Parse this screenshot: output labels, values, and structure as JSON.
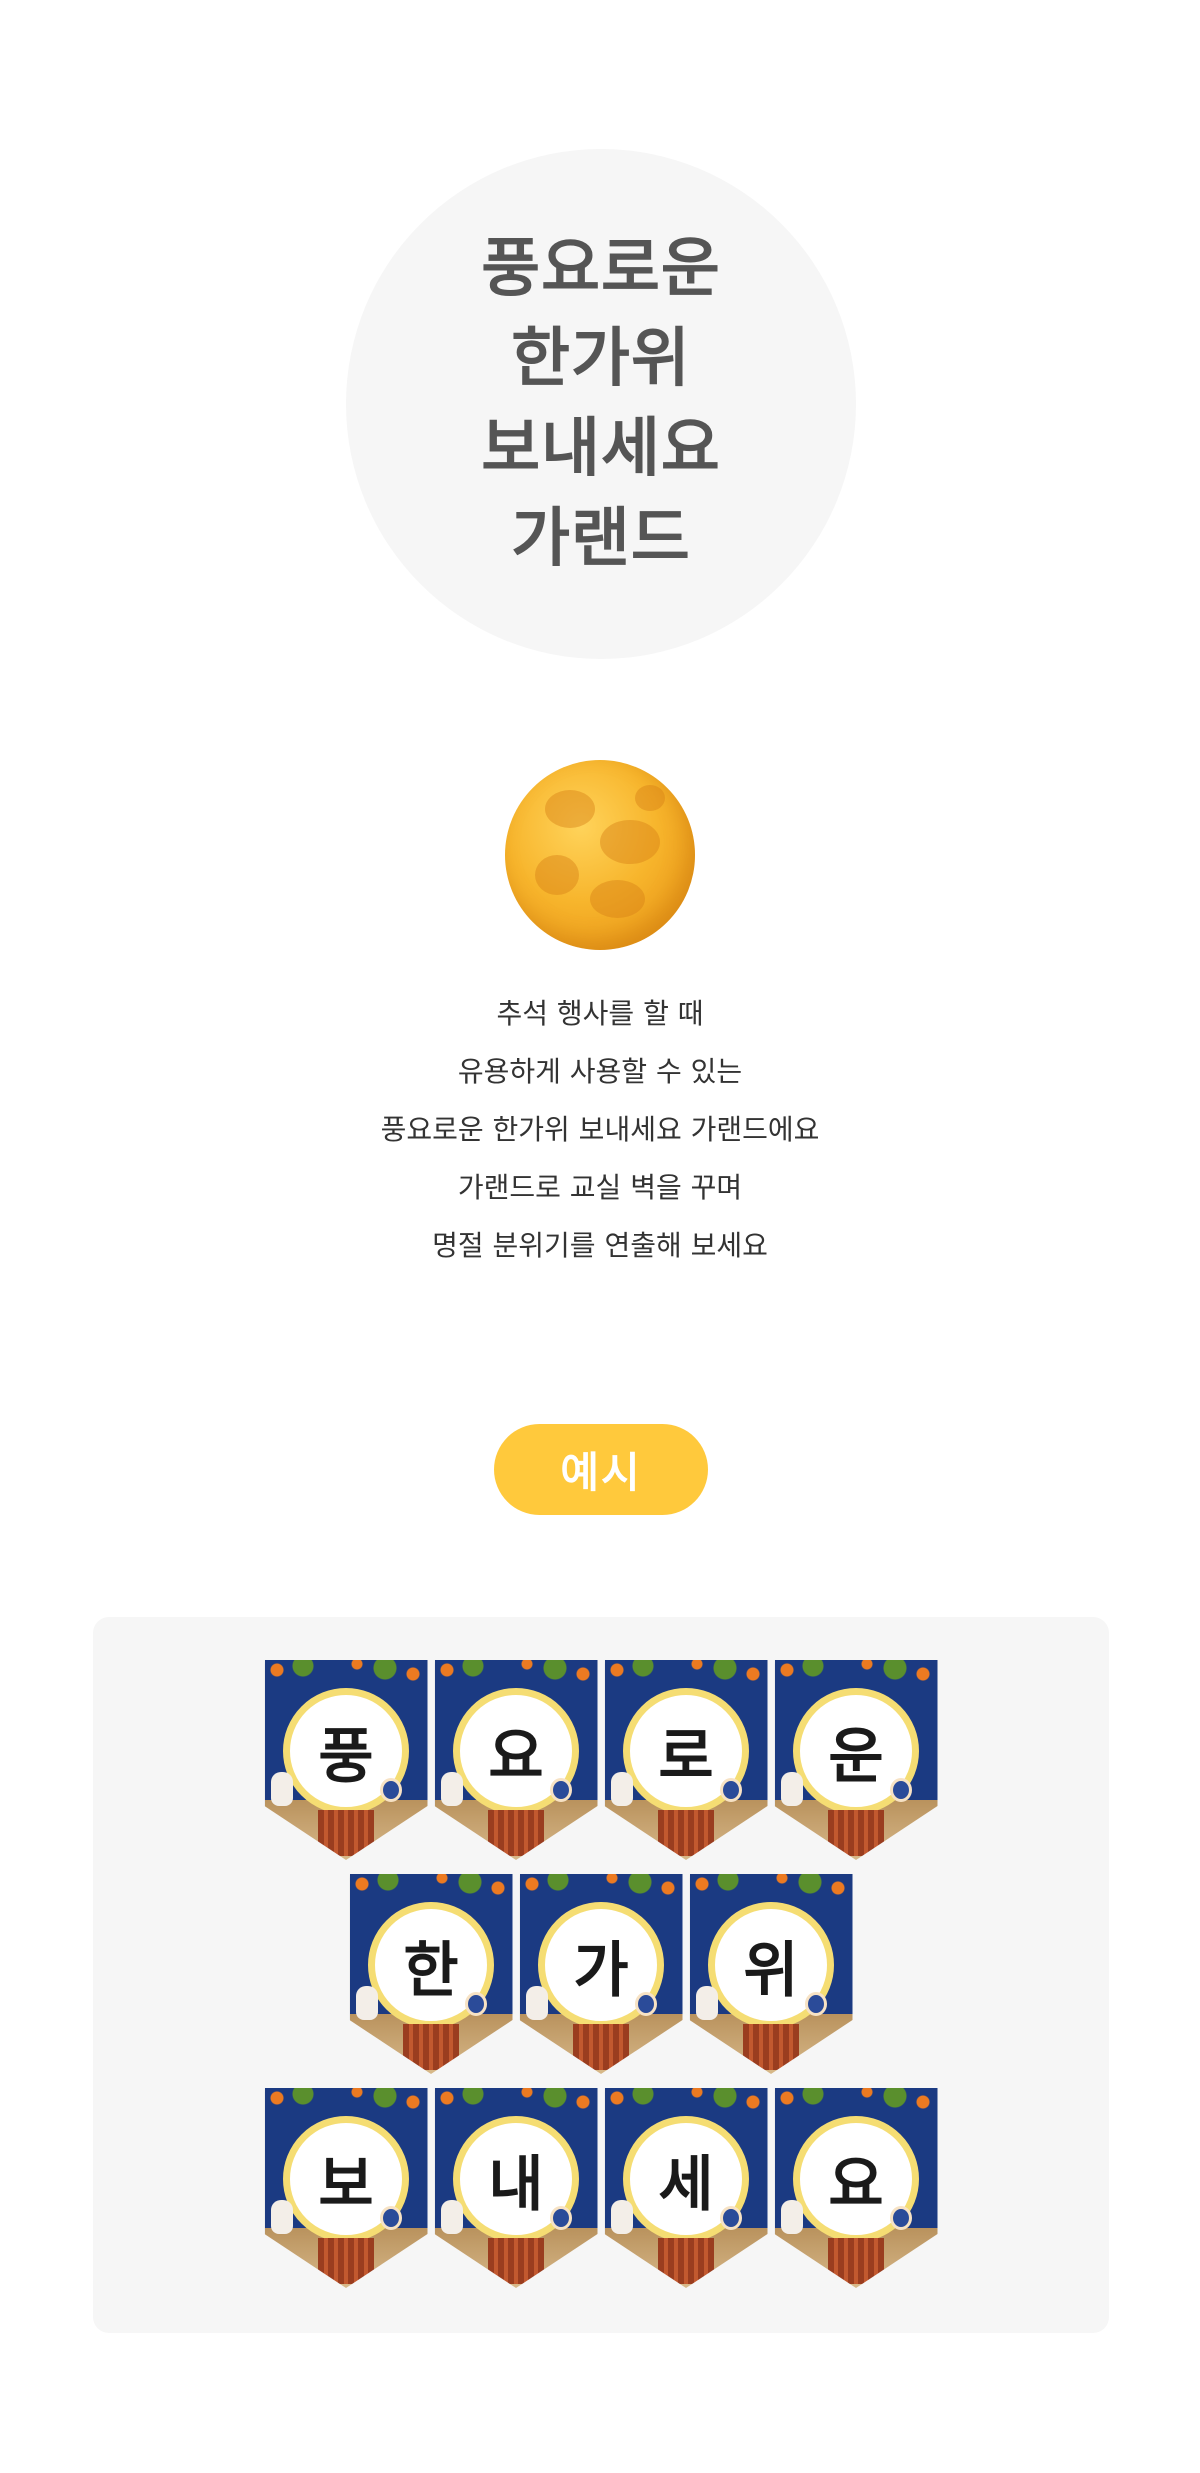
{
  "title_lines": [
    "풍요로운",
    "한가위",
    "보내세요",
    "가랜드"
  ],
  "description_lines": [
    "추석 행사를 할 때",
    "유용하게 사용할 수 있는",
    "풍요로운 한가위 보내세요 가랜드에요",
    "가랜드로 교실 벽을 꾸며",
    "명절 분위기를 연출해 보세요"
  ],
  "example_label": "예시",
  "garland_rows": [
    [
      "풍",
      "요",
      "로",
      "운"
    ],
    [
      "한",
      "가",
      "위"
    ],
    [
      "보",
      "내",
      "세",
      "요"
    ]
  ],
  "colors": {
    "title_circle": "#f6f6f6",
    "title_text": "#555555",
    "pill": "#ffc93c",
    "moon": "#f7b52c",
    "flag_background": "#1b3a82"
  },
  "icons": [
    "full-moon-icon"
  ]
}
